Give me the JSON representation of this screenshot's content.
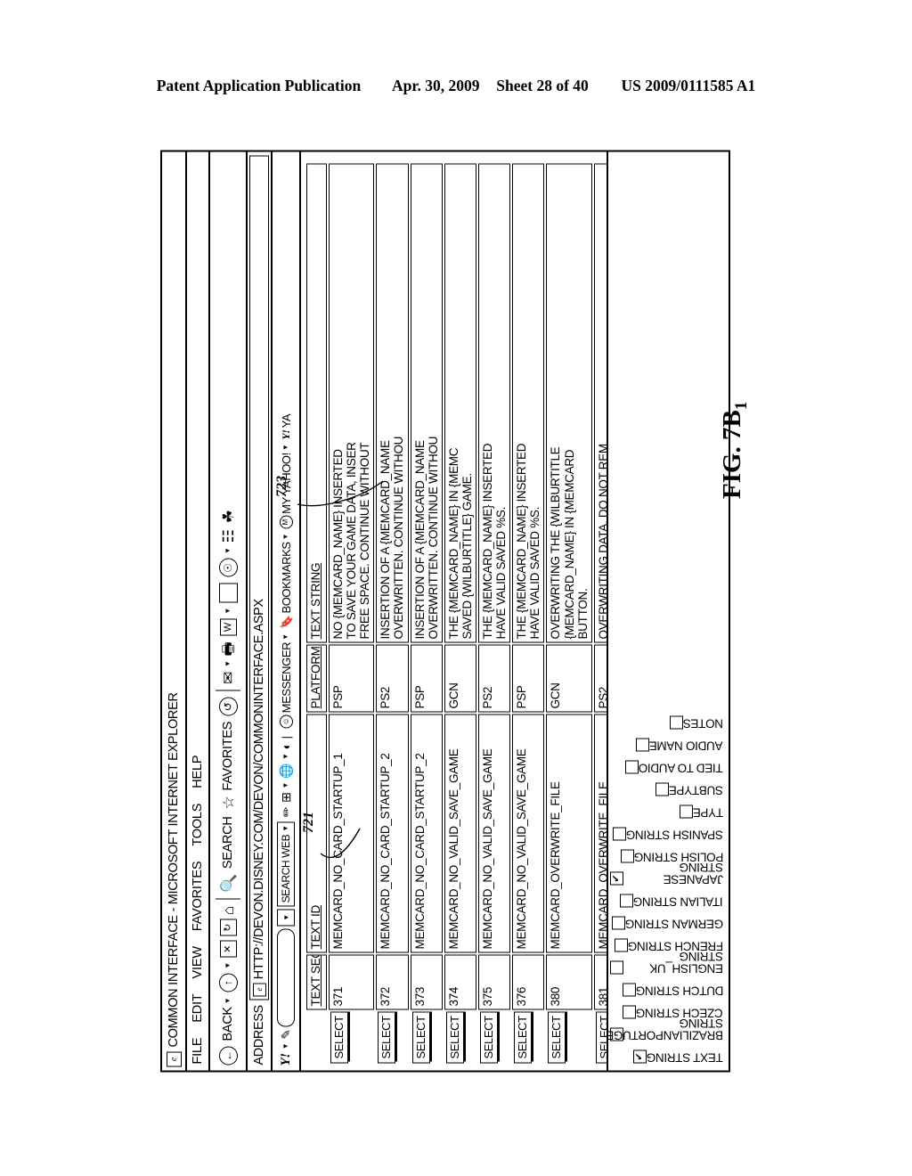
{
  "patent_header": {
    "publication": "Patent Application Publication",
    "date": "Apr. 30, 2009",
    "sheet": "Sheet 28 of 40",
    "number": "US 2009/0111585 A1"
  },
  "figure": {
    "caption": "FIG. 7B",
    "caption_sub": "1",
    "ref_721": "721",
    "ref_723": "723"
  },
  "browser": {
    "title": "COMMON INTERFACE - MICROSOFT INTERNET EXPLORER",
    "title_icon": "ie-logo-icon",
    "menus": [
      "FILE",
      "EDIT",
      "VIEW",
      "FAVORITES",
      "TOOLS",
      "HELP"
    ],
    "toolbar": {
      "back_label": "BACK",
      "back_icon": "back-arrow-icon",
      "forward_icon": "forward-arrow-icon",
      "stop_icon": "stop-x-icon",
      "refresh_icon": "refresh-icon",
      "home_icon": "home-icon",
      "search_label": "SEARCH",
      "search_icon": "magnifier-icon",
      "favorites_label": "FAVORITES",
      "favorites_icon": "star-icon",
      "history_icon": "history-clock-icon",
      "mail_icon": "mail-envelope-icon",
      "print_icon": "printer-icon",
      "edit_icon": "edit-w-icon",
      "page_icon": "blank-page-icon",
      "messenger_icon": "messenger-icon",
      "discuss_icon": "discuss-icon",
      "research_icon": "research-icon"
    },
    "address": {
      "label": "ADDRESS",
      "icon": "page-icon",
      "url": "HTTP://DEVON.DISNEY.COM/DEVON/COMMONINTERFACE.ASPX",
      "go_icon": "go-arrow-icon"
    },
    "yahoo_toolbar": {
      "logo": "Y!",
      "logo_caret": "▾",
      "pencil_icon": "pencil-icon",
      "search_value": "",
      "search_placeholder": "",
      "dropdown_icon": "chevron-down-icon",
      "search_web_label": "SEARCH WEB",
      "search_web_caret": "▾",
      "highlight_icon": "highlighter-icon",
      "tabs_icon": "tabs-icon",
      "globe_icon": "globe-icon",
      "antispy_icon": "antispy-icon",
      "messenger_label": "MESSENGER",
      "messenger_icon": "smiley-icon",
      "bookmarks_label": "BOOKMARKS",
      "bookmarks_icon": "bookmarks-icon",
      "my_yahoo_label": "MY YAHOO!",
      "my_yahoo_icon": "my-yahoo-icon",
      "yahoo_far_right": "YA",
      "yahoo_far_right_icon": "yahoo-y-icon"
    }
  },
  "table": {
    "headers": {
      "select": "",
      "text_seq": "TEXT SEQ",
      "text_id": "TEXT ID",
      "platform": "PLATFORM",
      "text_string": "TEXT STRING"
    },
    "select_label": "SELECT",
    "rows": [
      {
        "select": "SELECT",
        "text_seq": "371",
        "text_id": "MEMCARD_NO_CARD_STARTUP_1",
        "platform": "PSP",
        "text_string": "NO {MEMCARD_NAME} INSERTED\nTO SAVE YOUR GAME DATA, INSER\nFREE SPACE. CONTINUE WITHOUT"
      },
      {
        "select": "SELECT",
        "text_seq": "372",
        "text_id": "MEMCARD_NO_CARD_STARTUP_2",
        "platform": "PS2",
        "text_string": "INSERTION OF A {MEMCARD_NAME\nOVERWRITTEN. CONTINUE WITHOU"
      },
      {
        "select": "SELECT",
        "text_seq": "373",
        "text_id": "MEMCARD_NO_CARD_STARTUP_2",
        "platform": "PSP",
        "text_string": "INSERTION OF A {MEMCARD_NAME\nOVERWRITTEN. CONTINUE WITHOU"
      },
      {
        "select": "SELECT",
        "text_seq": "374",
        "text_id": "MEMCARD_NO_VALID_SAVE_GAME",
        "platform": "GCN",
        "text_string": "THE {MEMCARD_NAME} IN {MEMC\nSAVED {WILBURTITLE} GAME."
      },
      {
        "select": "SELECT",
        "text_seq": "375",
        "text_id": "MEMCARD_NO_VALID_SAVE_GAME",
        "platform": "PS2",
        "text_string": "THE {MEMCARD_NAME} INSERTED\nHAVE VALID SAVED %S."
      },
      {
        "select": "SELECT",
        "text_seq": "376",
        "text_id": "MEMCARD_NO_VALID_SAVE_GAME",
        "platform": "PSP",
        "text_string": "THE {MEMCARD_NAME} INSERTED\nHAVE VALID SAVED %S."
      },
      {
        "select": "SELECT",
        "text_seq": "380",
        "text_id": "MEMCARD_OVERWRITE_FILE",
        "platform": "GCN",
        "text_string": "OVERWRITING THE {WILBURTITLE\n{MEMCARD_NAME} IN {MEMCARD\nBUTTON."
      },
      {
        "select": "SELECT",
        "text_seq": "381",
        "text_id": "MEMCARD_OVERWRITE_FILE",
        "platform": "PS2",
        "text_string": "OVERWRITING DATA. DO NOT REM\n{MEMCARD_SLOTNAME} %S, CON"
      }
    ]
  },
  "field_checkboxes": [
    {
      "label": "TEXT STRING",
      "checked": true
    },
    {
      "label": "BRAZILIANPORTUGESE\nSTRING",
      "checked": false
    },
    {
      "label": "CZECH STRING",
      "checked": false
    },
    {
      "label": "DUTCH STRING",
      "checked": false
    },
    {
      "label": "ENGLISH_UK STRING",
      "checked": false
    },
    {
      "label": "FRENCH STRING",
      "checked": false
    },
    {
      "label": "GERMAN STRING",
      "checked": false
    },
    {
      "label": "ITALIAN STRING",
      "checked": false
    },
    {
      "label": "JAPANESE STRING",
      "checked": true
    },
    {
      "label": "POLISH STRING",
      "checked": false
    },
    {
      "label": "SPANISH STRING",
      "checked": false
    },
    {
      "label": "TYPE",
      "checked": false
    },
    {
      "label": "SUBTYPE",
      "checked": false
    },
    {
      "label": "TIED TO AUDIO",
      "checked": false
    },
    {
      "label": "AUDIO NAME",
      "checked": false
    },
    {
      "label": "NOTES",
      "checked": false
    }
  ]
}
